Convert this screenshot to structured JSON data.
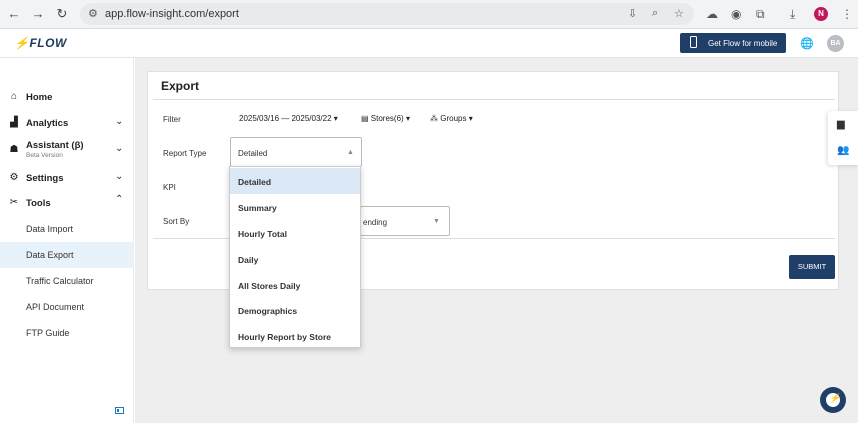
{
  "browser": {
    "url": "app.flow-insight.com/export",
    "profile_initial": "N"
  },
  "header": {
    "logo": "FLOW",
    "mobile_button": "Get Flow for mobile",
    "avatar_initials": "BA"
  },
  "sidebar": {
    "items": [
      {
        "label": "Home",
        "icon": "home-icon"
      },
      {
        "label": "Analytics",
        "icon": "chart-icon"
      },
      {
        "label": "Assistant (β)",
        "sub": "Beta Version",
        "icon": "robot-icon"
      },
      {
        "label": "Settings",
        "icon": "gear-icon"
      },
      {
        "label": "Tools",
        "icon": "tools-icon"
      }
    ],
    "tools_subitems": [
      "Data Import",
      "Data Export",
      "Traffic Calculator",
      "API Document",
      "FTP Guide"
    ],
    "active_subitem": "Data Export"
  },
  "export": {
    "title": "Export",
    "filter_label": "Filter",
    "date_range": "2025/03/16 — 2025/03/22",
    "stores": "Stores(6)",
    "groups": "Groups",
    "report_type_label": "Report Type",
    "report_type_value": "Detailed",
    "kpi_label": "KPI",
    "sort_by_label": "Sort By",
    "sort_value": "ending",
    "submit": "SUBMIT"
  },
  "dropdown": {
    "options": [
      "Detailed",
      "Summary",
      "Hourly Total",
      "Daily",
      "All Stores Daily",
      "Demographics",
      "Hourly Report by Store"
    ],
    "selected": "Detailed"
  },
  "colors": {
    "primary": "#1f3e68",
    "accent": "#1b78c4",
    "selected_bg": "#dbe9f7"
  }
}
